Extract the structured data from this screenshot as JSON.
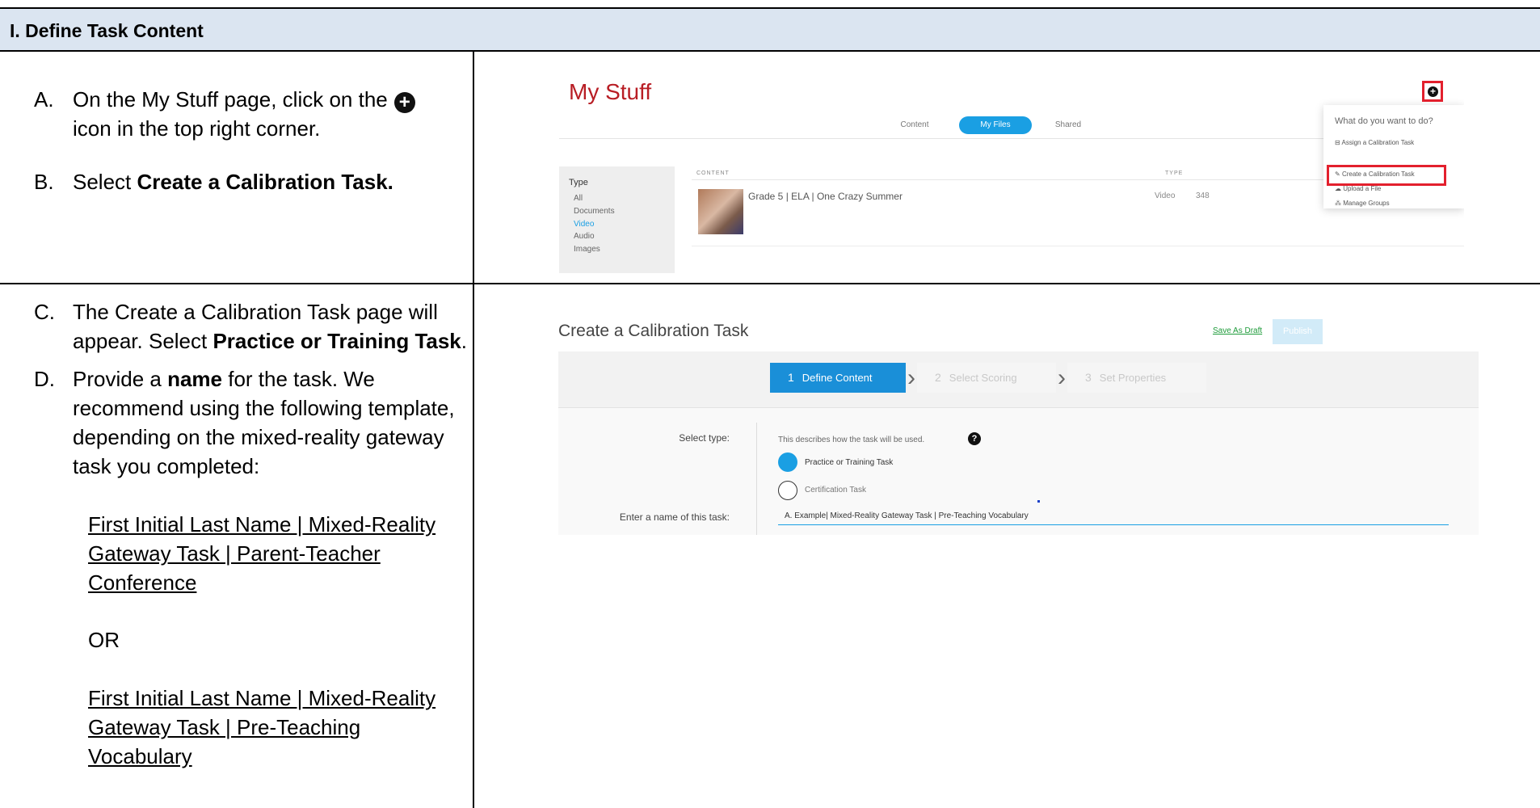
{
  "header": {
    "title": "I. Define Task Content"
  },
  "steps": {
    "a_label": "A.",
    "a_text_1": "On the My Stuff page, click on the",
    "a_icon": "plus-circle-icon",
    "a_text_2": "icon in the top right corner.",
    "b_label": "B.",
    "b_text_1": "Select ",
    "b_text_bold": "Create a Calibration Task.",
    "c_label": "C.",
    "c_text_1": "The Create a Calibration Task page will appear. Select ",
    "c_text_bold": "Practice or Training Task",
    "c_text_2": ".",
    "d_label": "D.",
    "d_text_1": "Provide a ",
    "d_text_bold": "name",
    "d_text_2": " for the task. We recommend using the following template, depending on the mixed-reality gateway task you completed:",
    "template_1": "First Initial Last Name | Mixed-Reality Gateway Task | Parent-Teacher Conference",
    "or_text": "OR",
    "template_2": "First Initial Last Name | Mixed-Reality Gateway Task | Pre-Teaching Vocabulary"
  },
  "my_stuff": {
    "title": "My Stuff",
    "tabs": [
      "Content",
      "My Files",
      "Shared"
    ],
    "active_tab": "My Files",
    "sidebar_heading": "Type",
    "sidebar_items": [
      "All",
      "Documents",
      "Video",
      "Audio",
      "Images"
    ],
    "selected_type": "Video",
    "columns": [
      "CONTENT",
      "TYPE"
    ],
    "row": {
      "name": "Grade 5 | ELA | One Crazy Summer",
      "type": "Video",
      "size": "348"
    },
    "menu_question": "What do you want to do?",
    "menu_items": [
      {
        "icon": "calibration-icon",
        "label": "Assign a Calibration Task"
      },
      {
        "icon": "pencil-icon",
        "label": "Create a Calibration Task"
      },
      {
        "icon": "cloud-upload-icon",
        "label": "Upload a File"
      },
      {
        "icon": "groups-icon",
        "label": "Manage Groups"
      }
    ],
    "highlight_color": "#e3202d"
  },
  "create_task": {
    "title": "Create a Calibration Task",
    "save_draft": "Save As Draft",
    "publish": "Publish",
    "steps": [
      {
        "num": "1",
        "label": "Define Content"
      },
      {
        "num": "2",
        "label": "Select Scoring"
      },
      {
        "num": "3",
        "label": "Set Properties"
      }
    ],
    "select_type_label": "Select type:",
    "select_type_desc": "This describes how the task will be used.",
    "options": [
      "Practice or Training Task",
      "Certification Task"
    ],
    "selected_option": "Practice or Training Task",
    "name_label": "Enter a name of this task:",
    "name_value": "A. Example| Mixed-Reality Gateway Task | Pre-Teaching Vocabulary",
    "accent_color": "#1a9fe3"
  }
}
